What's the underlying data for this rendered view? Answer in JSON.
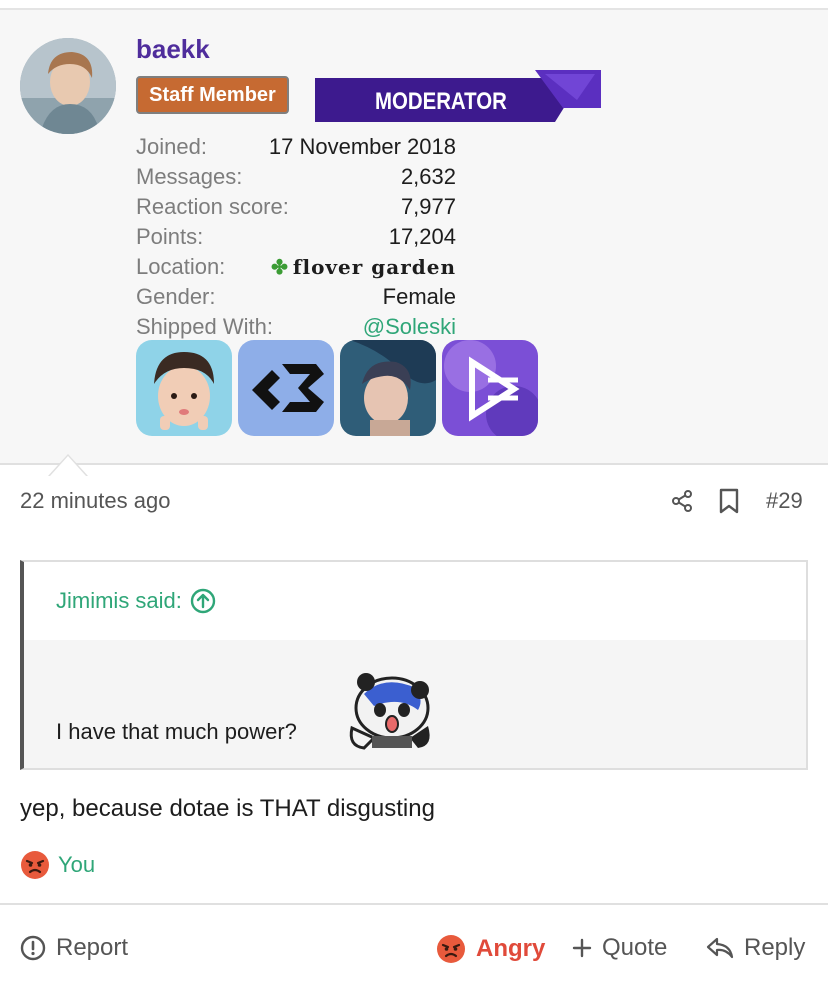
{
  "user": {
    "username": "baekk",
    "staff_badge": "Staff Member",
    "banner_text": "MODERATOR",
    "info": [
      {
        "label": "Joined:",
        "value": "17 November 2018"
      },
      {
        "label": "Messages:",
        "value": "2,632"
      },
      {
        "label": "Reaction score:",
        "value": "7,977"
      },
      {
        "label": "Points:",
        "value": "17,204"
      },
      {
        "label": "Location:",
        "value": "flover garden"
      },
      {
        "label": "Gender:",
        "value": "Female"
      },
      {
        "label": "Shipped With:",
        "value": "@Soleski"
      }
    ],
    "location_icon": "clover-icon",
    "ship_icons": [
      "avatar-child",
      "logo-blue",
      "avatar-portrait",
      "logo-purple"
    ]
  },
  "post": {
    "time": "22 minutes ago",
    "number": "#29",
    "quote": {
      "author": "Jimimis said:",
      "text": "I have that much power?"
    },
    "body": "yep, because dotae is THAT disgusting",
    "reaction_summary": "You"
  },
  "actions": {
    "report": "Report",
    "angry": "Angry",
    "quote": "Quote",
    "reply": "Reply"
  },
  "colors": {
    "username": "#4f2d9c",
    "link": "#2fa678",
    "staff_badge": "#c66a32",
    "banner": "#3d1a8e",
    "angry": "#e04a3a"
  }
}
